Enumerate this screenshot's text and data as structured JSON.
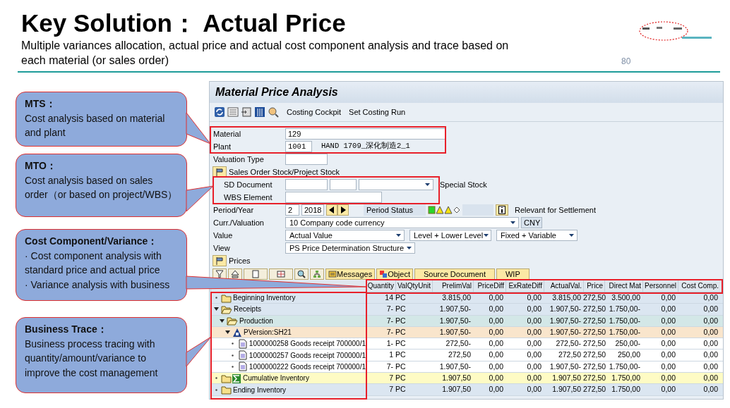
{
  "slide": {
    "title": "Key Solution： Actual Price",
    "subtitle": "Multiple variances allocation, actual price and actual cost component analysis and trace based on each material (or sales order)",
    "page_number": "80"
  },
  "callouts": [
    {
      "heading": "MTS：",
      "body": [
        "Cost analysis based on material and plant"
      ]
    },
    {
      "heading": "MTO：",
      "body": [
        "Cost analysis based on sales order（or based on project/WBS）"
      ]
    },
    {
      "heading": "Cost Component/Variance：",
      "body": [
        "· Cost component analysis with standard price and actual price",
        "· Variance analysis with business"
      ]
    },
    {
      "heading": "Business Trace：",
      "body": [
        "Business process tracing with quantity/amount/variance to improve the cost management"
      ]
    }
  ],
  "window": {
    "title": "Material Price Analysis",
    "toolbar": [
      "Costing Cockpit",
      "Set Costing Run"
    ]
  },
  "form": {
    "material": {
      "label": "Material",
      "value": "129"
    },
    "plant": {
      "label": "Plant",
      "value": "1001",
      "description": "HAND 1709_深化制造2_1"
    },
    "valuation_type": {
      "label": "Valuation Type"
    },
    "stock_section": {
      "label": "Sales Order Stock/Project Stock"
    },
    "sd_document": {
      "label": "SD Document",
      "extra_label": "Special Stock"
    },
    "wbs_element": {
      "label": "WBS Element"
    },
    "period_year": {
      "label": "Period/Year",
      "period": "2",
      "year": "2018",
      "status_label": "Period Status",
      "settlement_label": "Relevant for Settlement"
    },
    "curr_valuation": {
      "label": "Curr./Valuation",
      "value": "10 Company code currency",
      "currency": "CNY"
    },
    "value": {
      "label": "Value",
      "selections": [
        "Actual Value",
        "Level + Lower Level",
        "Fixed + Variable"
      ]
    },
    "view": {
      "label": "View",
      "value": "PS Price Determination Structure"
    }
  },
  "prices_section": {
    "label": "Prices"
  },
  "tree_toolbar": {
    "buttons": [
      {
        "label": "Messages",
        "kind": "messages"
      },
      {
        "label": "Object",
        "kind": "object"
      },
      {
        "label": "Source Document",
        "kind": "plain"
      },
      {
        "label": "WIP",
        "kind": "plain"
      }
    ]
  },
  "table": {
    "columns": [
      "Quantity",
      "ValQtyUnit",
      "PrelimVal",
      "PriceDiff",
      "ExRateDiff",
      "ActualVal.",
      "Price",
      "Direct Mat",
      "Personnel",
      "Cost Comp."
    ],
    "rows": [
      {
        "label": "Beginning Inventory",
        "kind": "folder",
        "expanded": false,
        "color": "#dbe6f1",
        "cells": [
          "14",
          "PC",
          "3.815,00",
          "0,00",
          "0,00",
          "3.815,00",
          "272,50",
          "3.500,00",
          "0,00",
          "0,00"
        ]
      },
      {
        "label": "Receipts",
        "kind": "open-folder",
        "expanded": true,
        "color": "#dbe6f1",
        "cells": [
          "7-",
          "PC",
          "1.907,50-",
          "0,00",
          "0,00",
          "1.907,50-",
          "272,50",
          "1.750,00-",
          "0,00",
          "0,00"
        ],
        "children": [
          {
            "label": "Production",
            "kind": "open-folder",
            "expanded": true,
            "color": "#d3e7e7",
            "cells": [
              "7-",
              "PC",
              "1.907,50-",
              "0,00",
              "0,00",
              "1.907,50-",
              "272,50",
              "1.750,00-",
              "0,00",
              "0,00"
            ],
            "children": [
              {
                "label": "PVersion:SH21",
                "kind": "version",
                "expanded": true,
                "color": "#f9e5cc",
                "cells": [
                  "7-",
                  "PC",
                  "1.907,50-",
                  "0,00",
                  "0,00",
                  "1.907,50-",
                  "272,50",
                  "1.750,00-",
                  "0,00",
                  "0,00"
                ],
                "children": [
                  {
                    "label": "1000000258 Goods receipt 700000/1",
                    "kind": "document",
                    "expanded": false,
                    "color": "#ffffff",
                    "cells": [
                      "1-",
                      "PC",
                      "272,50-",
                      "0,00",
                      "0,00",
                      "272,50-",
                      "272,50",
                      "250,00-",
                      "0,00",
                      "0,00"
                    ]
                  },
                  {
                    "label": "1000000257 Goods receipt 700000/1",
                    "kind": "document",
                    "expanded": false,
                    "color": "#ffffff",
                    "cells": [
                      "1",
                      "PC",
                      "272,50",
                      "0,00",
                      "0,00",
                      "272,50",
                      "272,50",
                      "250,00",
                      "0,00",
                      "0,00"
                    ]
                  },
                  {
                    "label": "1000000222 Goods receipt 700000/1",
                    "kind": "document",
                    "expanded": false,
                    "color": "#ffffff",
                    "cells": [
                      "7-",
                      "PC",
                      "1.907,50-",
                      "0,00",
                      "0,00",
                      "1.907,50-",
                      "272,50",
                      "1.750,00-",
                      "0,00",
                      "0,00"
                    ]
                  }
                ]
              }
            ]
          }
        ]
      },
      {
        "label": "Cumulative Inventory",
        "kind": "sum-folder",
        "expanded": false,
        "color": "#fefbc4",
        "cells": [
          "7",
          "PC",
          "1.907,50",
          "0,00",
          "0,00",
          "1.907,50",
          "272,50",
          "1.750,00",
          "0,00",
          "0,00"
        ]
      },
      {
        "label": "Ending Inventory",
        "kind": "folder",
        "expanded": false,
        "color": "#dbe6f1",
        "cells": [
          "7",
          "PC",
          "1.907,50",
          "0,00",
          "0,00",
          "1.907,50",
          "272,50",
          "1.750,00",
          "0,00",
          "0,00"
        ]
      }
    ]
  }
}
